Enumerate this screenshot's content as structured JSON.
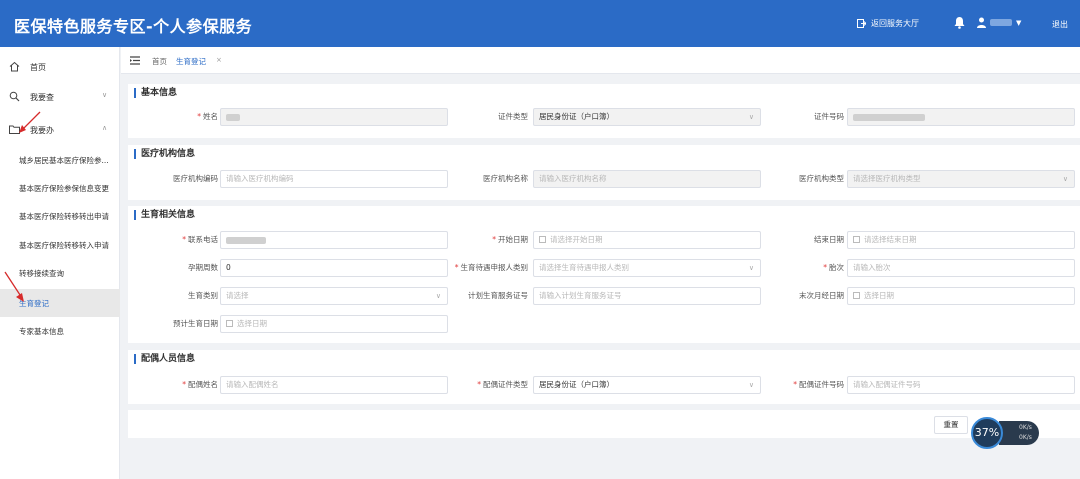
{
  "header": {
    "title": "医保特色服务专区-个人参保服务",
    "back_label": "返回服务大厅",
    "logout_label": "退出"
  },
  "sidebar": {
    "items": [
      {
        "label": "首页",
        "icon": "home-icon"
      },
      {
        "label": "我要查",
        "icon": "search-icon",
        "arrow": "∨"
      },
      {
        "label": "我要办",
        "icon": "folder-icon",
        "arrow": "∧"
      }
    ],
    "sub_items": [
      {
        "label": "城乡居民基本医疗保险参..."
      },
      {
        "label": "基本医疗保险参保信息变更"
      },
      {
        "label": "基本医疗保险转移转出申请"
      },
      {
        "label": "基本医疗保险转移转入申请"
      },
      {
        "label": "转移接续查询"
      },
      {
        "label": "生育登记",
        "active": true
      },
      {
        "label": "专家基本信息"
      }
    ]
  },
  "tabs": {
    "home": "首页",
    "current": "生育登记",
    "close": "×"
  },
  "sections": {
    "basic": {
      "title": "基本信息",
      "name_label": "姓名",
      "idtype_label": "证件类型",
      "idtype_value": "居民身份证（户口簿）",
      "idno_label": "证件号码"
    },
    "medical": {
      "title": "医疗机构信息",
      "code_label": "医疗机构编码",
      "code_placeholder": "请输入医疗机构编码",
      "name_label": "医疗机构名称",
      "name_placeholder": "请输入医疗机构名称",
      "type_label": "医疗机构类型",
      "type_placeholder": "请选择医疗机构类型"
    },
    "birth": {
      "title": "生育相关信息",
      "phone_label": "联系电话",
      "start_label": "开始日期",
      "start_placeholder": "请选择开始日期",
      "end_label": "结束日期",
      "end_placeholder": "请选择结束日期",
      "weeks_label": "孕期周数",
      "weeks_value": "0",
      "category_label": "生育待遇申报人类别",
      "category_placeholder": "请选择生育待遇申报人类别",
      "fetus_label": "胎次",
      "fetus_placeholder": "请输入胎次",
      "birthtype_label": "生育类别",
      "birthtype_placeholder": "请选择",
      "cert_label": "计划生育服务证号",
      "cert_placeholder": "请输入计划生育服务证号",
      "lmp_label": "末次月经日期",
      "lmp_placeholder": "选择日期",
      "due_label": "预计生育日期",
      "due_placeholder": "选择日期"
    },
    "spouse": {
      "title": "配偶人员信息",
      "name_label": "配偶姓名",
      "name_placeholder": "请输入配偶姓名",
      "idtype_label": "配偶证件类型",
      "idtype_value": "居民身份证（户口簿）",
      "idno_label": "配偶证件号码",
      "idno_placeholder": "请输入配偶证件号码"
    }
  },
  "actions": {
    "reset_label": "重置"
  },
  "widget": {
    "percent": "37%",
    "up": "0K/s",
    "down": "0K/s"
  },
  "colors": {
    "primary": "#2b6bc6",
    "required": "#e03a3a",
    "arrow": "#d62b2b"
  }
}
